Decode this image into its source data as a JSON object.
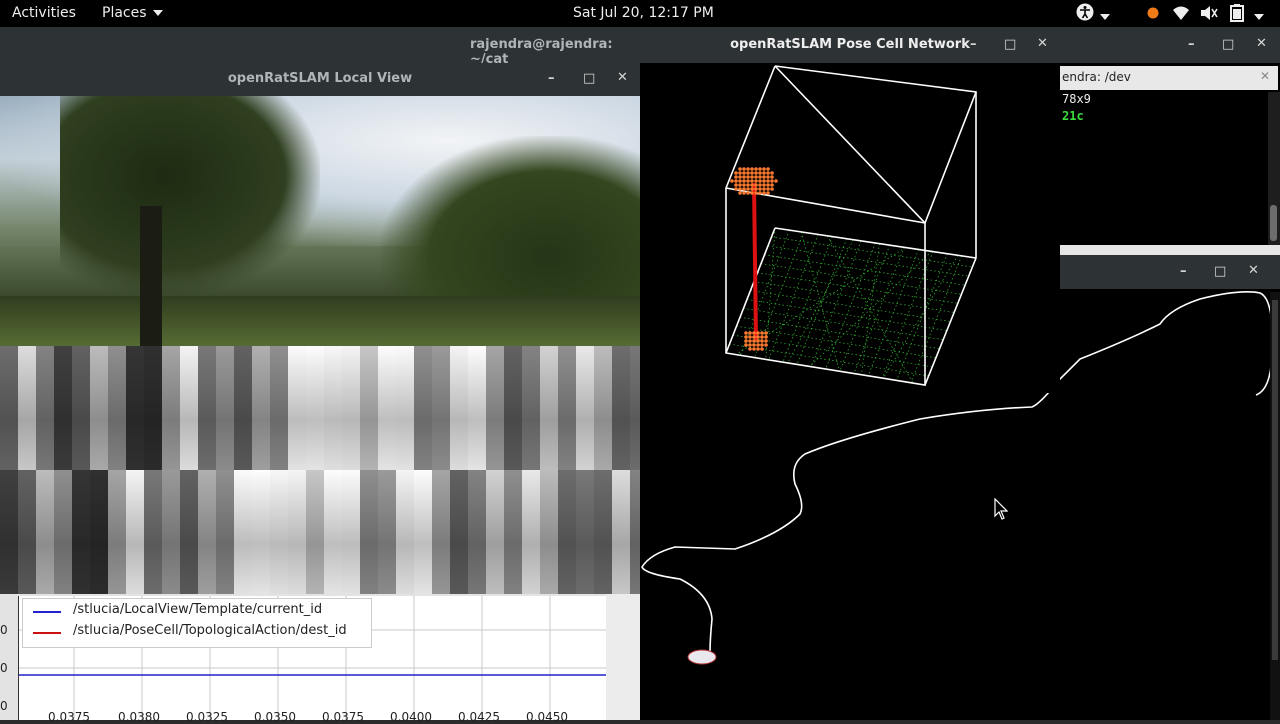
{
  "topbar": {
    "activities": "Activities",
    "places": "Places",
    "clock": "Sat Jul 20, 12:17 PM"
  },
  "windows": {
    "terminal_bg": {
      "title": "rajendra@rajendra: ~/cat"
    },
    "local_view": {
      "title": "openRatSLAM Local View"
    },
    "pose_cell": {
      "title": "openRatSLAM Pose Cell Network"
    },
    "terminal_small": {
      "tab_label": "endra: /dev",
      "line1": "78x9",
      "line2": "21c"
    }
  },
  "plot": {
    "legend": [
      {
        "label": "/stlucia/LocalView/Template/current_id",
        "color": "#2222cc"
      },
      {
        "label": "/stlucia/PoseCell/TopologicalAction/dest_id",
        "color": "#cc1111"
      }
    ],
    "y_ticks": [
      "0",
      "0",
      "0"
    ],
    "x_ticks": [
      "0.0375",
      "0.0380",
      "0.0325",
      "0.0350",
      "0.0375",
      "0.0400",
      "0.0425",
      "0.0450"
    ]
  },
  "colors": {
    "trajectory": "#ffffff",
    "posecell_grid": "#3fdc3f",
    "posecell_activity": "#ff7a30",
    "posecell_link": "#dd1111"
  }
}
